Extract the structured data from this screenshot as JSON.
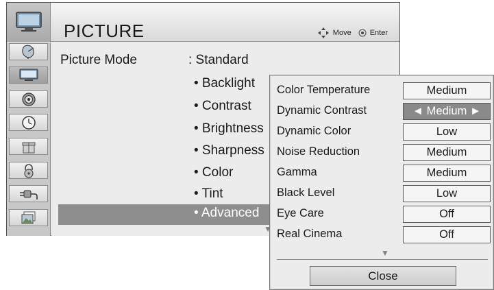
{
  "header": {
    "title": "PICTURE",
    "icon": "tv-icon",
    "hints": {
      "move": "Move",
      "enter": "Enter"
    }
  },
  "categories": [
    {
      "icon": "satellite-dish-icon",
      "active": false
    },
    {
      "icon": "tv-icon",
      "active": true
    },
    {
      "icon": "speaker-icon",
      "active": false
    },
    {
      "icon": "clock-icon",
      "active": false
    },
    {
      "icon": "gift-box-icon",
      "active": false
    },
    {
      "icon": "lock-icon",
      "active": false
    },
    {
      "icon": "input-plug-icon",
      "active": false
    },
    {
      "icon": "photo-media-icon",
      "active": false
    }
  ],
  "main": {
    "mode_label": "Picture Mode",
    "mode_value": ": Standard",
    "items": [
      "• Backlight",
      "• Contrast",
      "• Brightness",
      "• Sharpness",
      "• Color",
      "• Tint"
    ],
    "advanced_label": "• Advanced",
    "scroll_arrow": "▼"
  },
  "advanced": {
    "settings": [
      {
        "label": "Color Temperature",
        "value": "Medium",
        "selected": false
      },
      {
        "label": "Dynamic Contrast",
        "value": "◄ Medium ►",
        "selected": true
      },
      {
        "label": "Dynamic Color",
        "value": "Low",
        "selected": false
      },
      {
        "label": "Noise Reduction",
        "value": "Medium",
        "selected": false
      },
      {
        "label": "Gamma",
        "value": "Medium",
        "selected": false
      },
      {
        "label": "Black Level",
        "value": "Low",
        "selected": false
      },
      {
        "label": "Eye Care",
        "value": "Off",
        "selected": false
      },
      {
        "label": "Real Cinema",
        "value": "Off",
        "selected": false
      }
    ],
    "scroll_arrow": "▼",
    "close_label": "Close"
  },
  "colors": {
    "selected_bg": "#8a8a8a",
    "selected_text": "#ffffff",
    "frame": "#555555"
  }
}
